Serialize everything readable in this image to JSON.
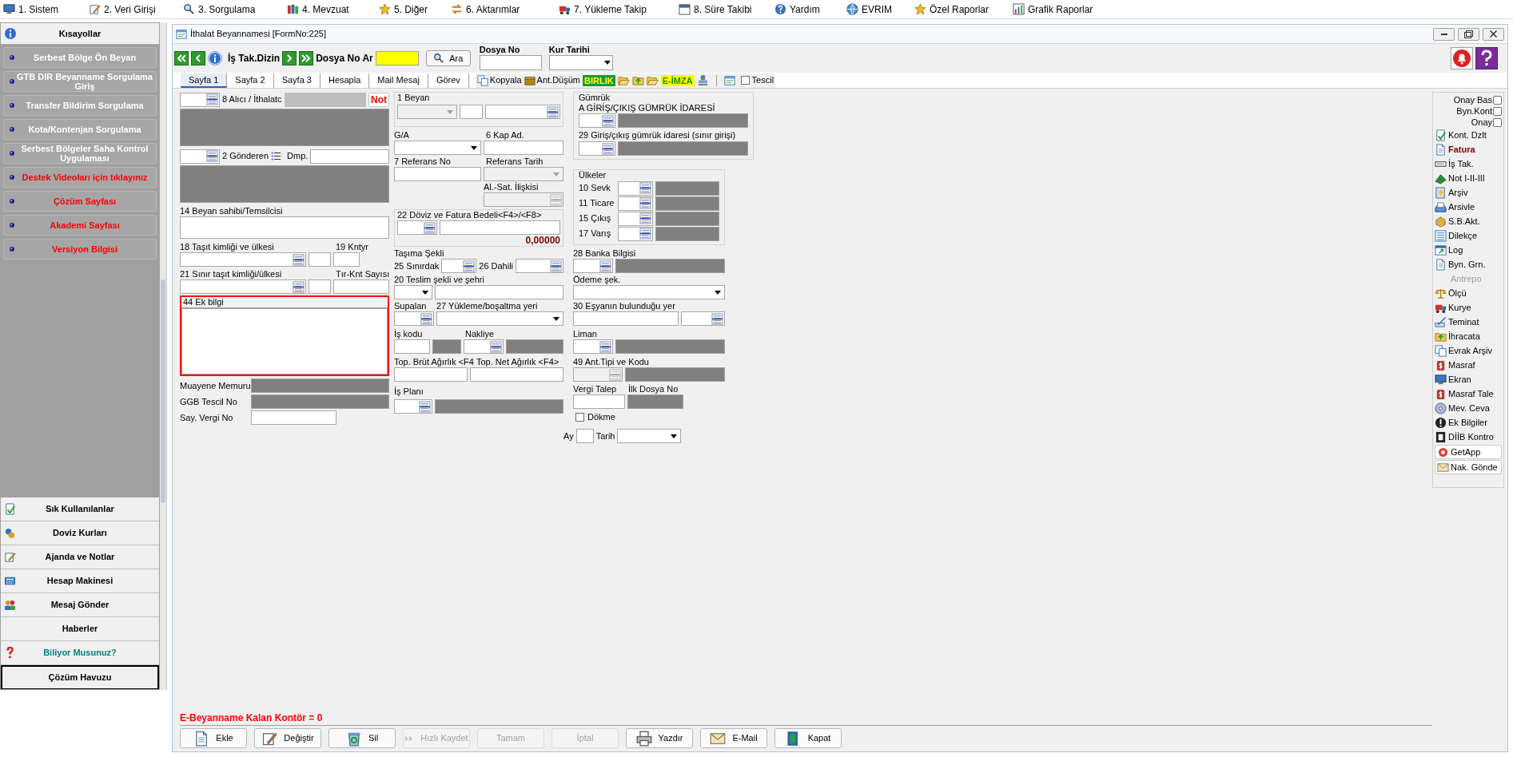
{
  "menu_bar": [
    "1. Sistem",
    "2. Veri Girişi",
    "3. Sorgulama",
    "4. Mevzuat",
    "5. Diğer",
    "6. Aktarımlar",
    "7. Yükleme Takip",
    "8. Süre Takibi",
    "Yardım",
    "EVRIM",
    "Özel Raporlar",
    "Grafik Raporlar"
  ],
  "sidebar": {
    "title": "Kısayollar",
    "shortcuts": [
      {
        "label": "Serbest Bölge Ön Beyan",
        "color": "#ffffff"
      },
      {
        "label": "GTB DIR Beyanname Sorgulama Giriş",
        "color": "#ffffff"
      },
      {
        "label": "Transfer Bildirim Sorgulama",
        "color": "#ffffff"
      },
      {
        "label": "Kota/Kontenjan Sorgulama",
        "color": "#ffffff"
      },
      {
        "label": "Serbest Bölgeler Saha Kontrol Uygulaması",
        "color": "#ffffff"
      },
      {
        "label": "Destek Videoları için tıklayınız",
        "color": "#ff0000"
      },
      {
        "label": "Çözüm Sayfası",
        "color": "#ff0000"
      },
      {
        "label": "Akademi Sayfası",
        "color": "#ff0000"
      },
      {
        "label": "Versiyon Bilgisi",
        "color": "#ff0000"
      }
    ],
    "bottom_items": [
      {
        "label": "Sık Kullanılanlar",
        "color": "#000000",
        "selected": false
      },
      {
        "label": "Doviz Kurları",
        "color": "#000000",
        "selected": false
      },
      {
        "label": "Ajanda ve Notlar",
        "color": "#000000",
        "selected": false
      },
      {
        "label": "Hesap Makinesi",
        "color": "#000000",
        "selected": false
      },
      {
        "label": "Mesaj Gönder",
        "color": "#000000",
        "selected": false
      },
      {
        "label": "Haberler",
        "color": "#000000",
        "selected": false
      },
      {
        "label": "Biliyor Musunuz?",
        "color": "#007f7f",
        "selected": false
      },
      {
        "label": "Çözüm Havuzu",
        "color": "#000000",
        "selected": true
      }
    ]
  },
  "window": {
    "title": "İthalat Beyannamesi [FormNo:225]"
  },
  "toolbar": {
    "index_label": "İş Tak.Dizin",
    "search_label": "Dosya No Ar",
    "search_button": "Ara",
    "file_no_label": "Dosya No",
    "rate_date_label": "Kur Tarihi"
  },
  "tabs": [
    {
      "label": "Sayfa 1",
      "selected": true
    },
    {
      "label": "Sayfa 2",
      "selected": false
    },
    {
      "label": "Sayfa 3",
      "selected": false
    },
    {
      "label": "Hesapla",
      "selected": false
    },
    {
      "label": "Mail Mesaj",
      "selected": false
    },
    {
      "label": "Görev",
      "selected": false
    }
  ],
  "tab_tools": {
    "copy": "Kopyala",
    "deduction": "Ant.Düşüm",
    "union_badge": "BIRLIK",
    "signature_badge": "E-İMZA",
    "registration": {
      "label": "Tescil",
      "checked": false
    }
  },
  "form": {
    "left_labels": [
      "8 Alıcı / İthalatc",
      "2 Gönderen",
      "Dmp.",
      "14 Beyan sahibi/Temsilcisi",
      "18 Taşıt kimliği ve ülkesi",
      "19 Kntyr",
      "21 Sınır taşıt kimliği/ülkesi",
      "Tır-Knt Sayısı",
      "44 Ek bilgi",
      "Muayene Memuru",
      "GGB Tescil No",
      "Say. Vergi No"
    ],
    "note_button": "Not",
    "middle_labels": [
      "1 Beyan",
      "G/A",
      "6 Kap Ad.",
      "7 Referans No",
      "Referans Tarih",
      "Al.-Sat. İlişkisi",
      "22 Döviz ve Fatura Bedeli<F4>/<F8>",
      "Taşıma Şekli",
      "25 Sınırdak",
      "26 Dahili",
      "20 Teslim şekli ve şehri",
      "Supalan",
      "27 Yükleme/boşaltma yeri",
      "İş kodu",
      "Nakliye",
      "Top. Brüt Ağırlık <F4",
      "Top. Net Ağırlık <F4>",
      "İş Planı"
    ],
    "invoice_total": "0,00000",
    "right_labels": [
      "Gümrük",
      "A GİRİŞ/ÇIKIŞ GÜMRÜK İDARESİ",
      "29 Giriş/çıkış gümrük idaresi (sınır girişi)",
      "Ülkeler",
      "10 Sevk",
      "11 Ticare",
      "15 Çıkış",
      "17 Varış",
      "28 Banka Bilgisi",
      "Ödeme şek.",
      "30 Eşyanın bulunduğu yer",
      "Liman",
      "49 Ant.Tipi ve Kodu",
      "Vergi Talep",
      "İlk Dosya No",
      "Ay",
      "Tarih"
    ],
    "bulk": {
      "label": "Dökme",
      "checked": false
    }
  },
  "side_tools": [
    {
      "kind": "checkbox",
      "label": "Onay Bas",
      "checked": false
    },
    {
      "kind": "checkbox",
      "label": "Byn.Kont",
      "checked": false
    },
    {
      "kind": "checkbox",
      "label": "Onay",
      "checked": false
    },
    {
      "kind": "tool",
      "label": "Kont. Dzlt"
    },
    {
      "kind": "emphasis",
      "label": "Fatura"
    },
    {
      "kind": "tool",
      "label": "İş Tak."
    },
    {
      "kind": "tool",
      "label": "Not I-II-III"
    },
    {
      "kind": "tool",
      "label": "Arşiv"
    },
    {
      "kind": "tool",
      "label": "Arsivle"
    },
    {
      "kind": "tool",
      "label": "S.B.Akt."
    },
    {
      "kind": "tool",
      "label": "Dilekçe"
    },
    {
      "kind": "tool",
      "label": "Log"
    },
    {
      "kind": "tool",
      "label": "Byn. Grn."
    },
    {
      "kind": "section",
      "label": "Antrepo"
    },
    {
      "kind": "tool",
      "label": "Ölçü"
    },
    {
      "kind": "tool",
      "label": "Kurye"
    },
    {
      "kind": "tool",
      "label": "Teminat"
    },
    {
      "kind": "tool",
      "label": "İhracata"
    },
    {
      "kind": "tool",
      "label": "Evrak Arşiv"
    },
    {
      "kind": "tool",
      "label": "Masraf"
    },
    {
      "kind": "tool",
      "label": "Ekran"
    },
    {
      "kind": "tool",
      "label": "Masraf Tale"
    },
    {
      "kind": "tool",
      "label": "Mev. Ceva"
    },
    {
      "kind": "tool",
      "label": "Ek Bilgiler"
    },
    {
      "kind": "tool",
      "label": "DİİB Kontro"
    },
    {
      "kind": "framed",
      "label": "GetApp"
    },
    {
      "kind": "framed",
      "label": "Nak. Gönde"
    }
  ],
  "footer": {
    "balance": "E-Beyanname Kalan Kontör = 0",
    "buttons": [
      {
        "label": "Ekle",
        "disabled": false
      },
      {
        "label": "Değiştir",
        "disabled": false
      },
      {
        "label": "Sil",
        "disabled": false
      },
      {
        "label": "Hızlı Kaydet",
        "disabled": true
      },
      {
        "label": "Tamam",
        "disabled": true
      },
      {
        "label": "İptal",
        "disabled": true
      },
      {
        "label": "Yazdır",
        "disabled": false
      },
      {
        "label": "E-Mail",
        "disabled": false
      },
      {
        "label": "Kapat",
        "disabled": false
      }
    ]
  }
}
